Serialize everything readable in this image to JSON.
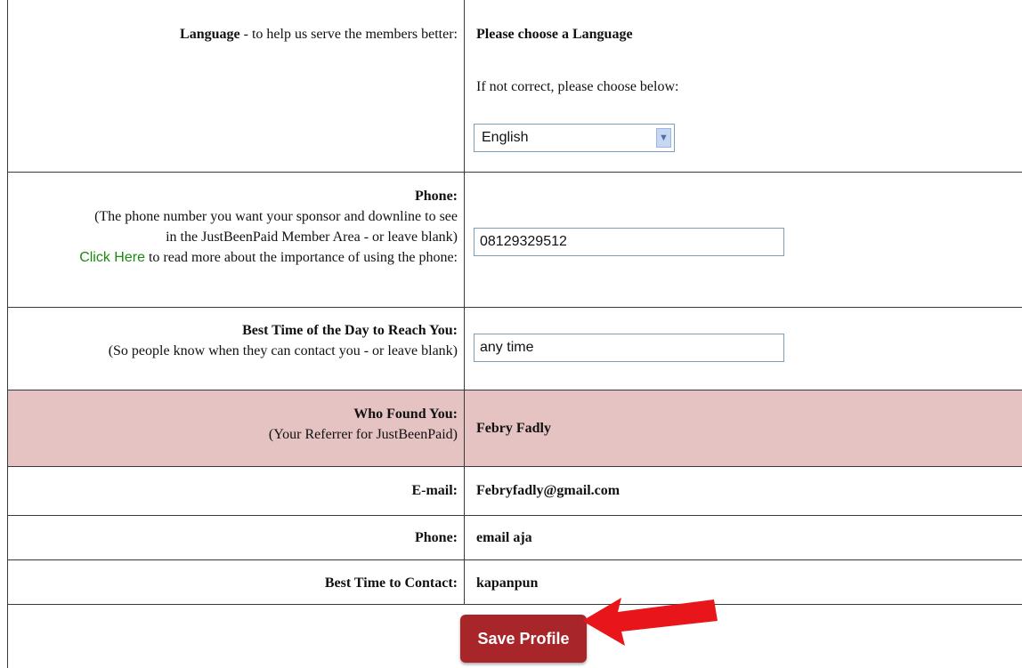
{
  "language": {
    "label": "Language",
    "label_suffix": " - to help us serve the members better:",
    "heading": "Please choose a Language",
    "hint": "If not correct, please choose below:",
    "selected": "English"
  },
  "phone_field": {
    "label": "Phone:",
    "desc_line1": "(The phone number you want your sponsor and downline to see",
    "desc_line2": "in the JustBeenPaid Member Area - or leave blank)",
    "link": "Click Here",
    "link_suffix": " to read more about the importance of using the phone:",
    "value": "08129329512"
  },
  "best_time_field": {
    "label": "Best Time of the Day to Reach You:",
    "desc": "(So people know when they can contact you - or leave blank)",
    "value": "any time"
  },
  "referrer": {
    "label": "Who Found You:",
    "desc": "(Your Referrer for JustBeenPaid)",
    "name": "Febry Fadly",
    "highlight_color": "#e6c3c3"
  },
  "referrer_contact": {
    "email_label": "E-mail:",
    "email": "Febryfadly@gmail.com",
    "phone_label": "Phone:",
    "phone": "email aja",
    "best_time_label": "Best Time to Contact:",
    "best_time": "kapanpun"
  },
  "save_button": {
    "label": "Save Profile",
    "color": "#a8252a"
  },
  "annotation_arrow_color": "#e8161b"
}
